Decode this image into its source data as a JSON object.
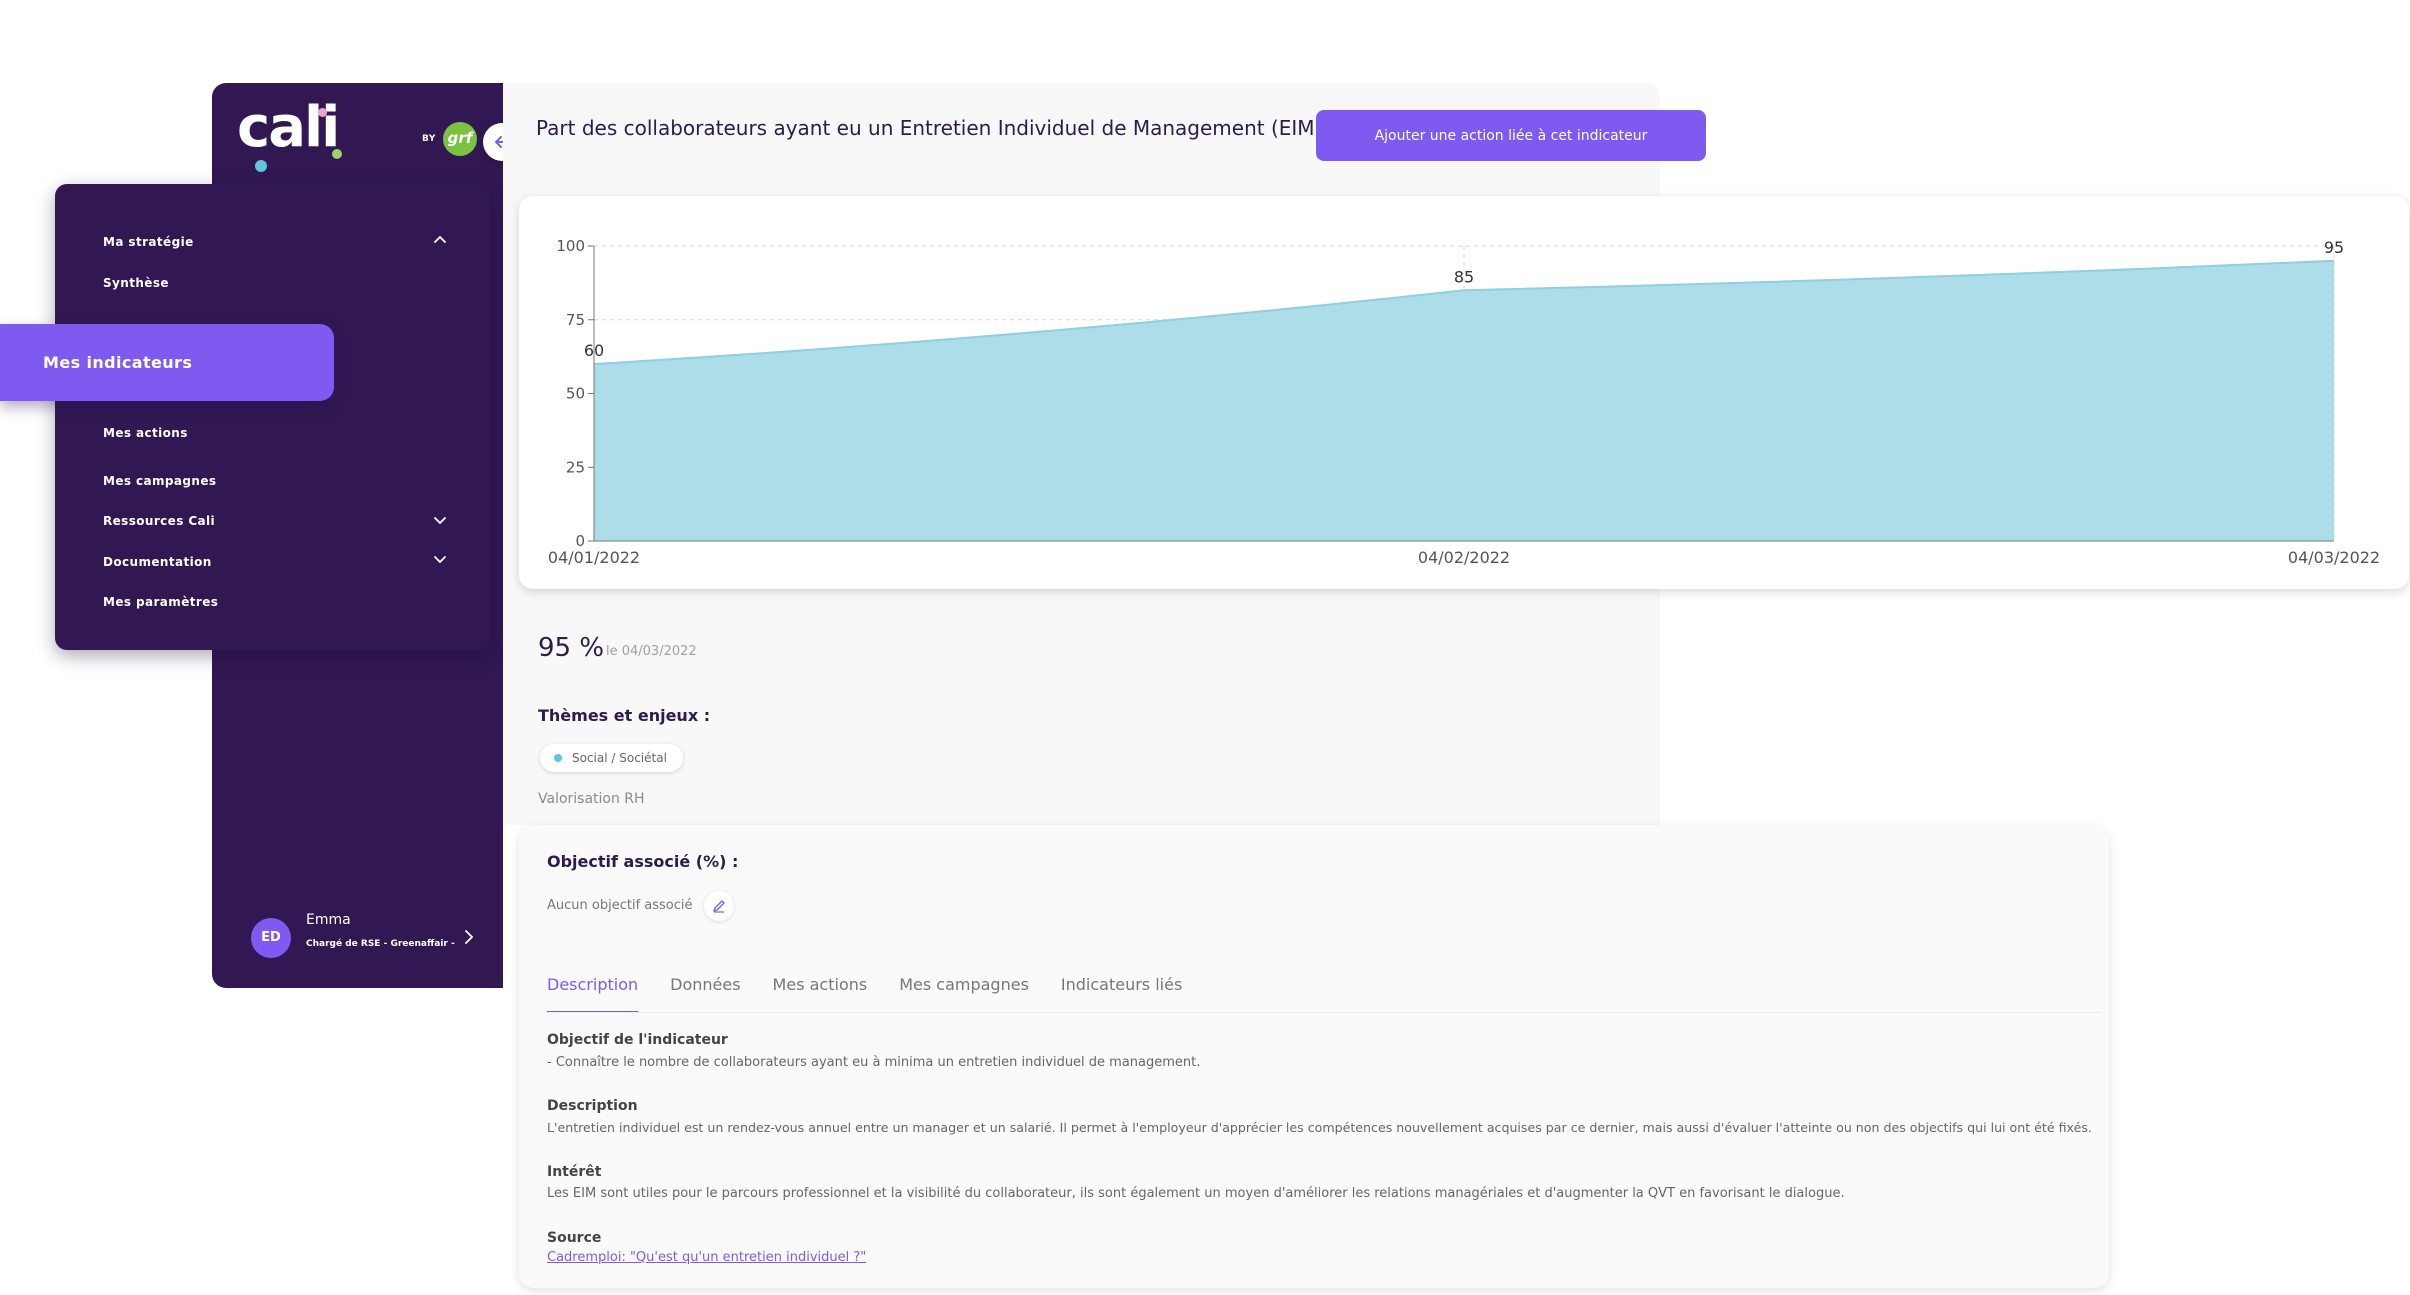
{
  "brand": {
    "logo_text": "cali",
    "by_label": "BY",
    "partner_badge": "grf",
    "colors": {
      "sidebar": "#311853",
      "accent": "#7f5af0",
      "area_fill": "#acdde8",
      "area_stroke": "#8fcfdf"
    }
  },
  "sidebar": {
    "collapse_icon": "arrow-left-icon",
    "items": [
      {
        "label": "Ma stratégie",
        "chevron": "up"
      },
      {
        "label": "Synthèse"
      },
      {
        "label": "Mes indicateurs",
        "active": true
      },
      {
        "label": "Mes actions"
      },
      {
        "label": "Mes campagnes"
      },
      {
        "label": "Ressources Cali",
        "chevron": "down"
      },
      {
        "label": "Documentation",
        "chevron": "down"
      },
      {
        "label": "Mes paramètres"
      }
    ],
    "user": {
      "initials": "ED",
      "name": "Emma",
      "role": "Chargé de RSE - Greenaffair -"
    }
  },
  "header": {
    "title": "Part des collaborateurs ayant eu un Entretien Individuel de Management (EIM)",
    "add_action_label": "Ajouter une action liée à cet indicateur"
  },
  "chart_data": {
    "type": "area",
    "x": [
      "04/01/2022",
      "04/02/2022",
      "04/03/2022"
    ],
    "values": [
      60,
      85,
      95
    ],
    "data_labels": [
      "60",
      "85",
      "95"
    ],
    "yticks": [
      0,
      25,
      50,
      75,
      100
    ],
    "ylim": [
      0,
      100
    ],
    "grid": true,
    "title": "",
    "xlabel": "",
    "ylabel": ""
  },
  "summary": {
    "value": "95 %",
    "date": "le 04/03/2022"
  },
  "themes": {
    "title": "Thèmes et enjeux :",
    "chip": "Social / Sociétal",
    "sub": "Valorisation RH"
  },
  "objective": {
    "title": "Objectif associé (%) :",
    "empty_text": "Aucun objectif associé"
  },
  "tabs": [
    {
      "label": "Description",
      "active": true
    },
    {
      "label": "Données"
    },
    {
      "label": "Mes actions"
    },
    {
      "label": "Mes campagnes"
    },
    {
      "label": "Indicateurs liés"
    }
  ],
  "details": {
    "objective_label": "Objectif de l'indicateur",
    "objective_text": "- Connaître le nombre de collaborateurs ayant eu à minima un entretien individuel de management.",
    "description_label": "Description",
    "description_text": "L'entretien individuel est un rendez-vous annuel entre un manager et un salarié. Il permet à l'employeur d'apprécier les compétences nouvellement acquises par ce dernier, mais aussi d'évaluer l'atteinte ou non des objectifs qui lui ont été fixés.",
    "interest_label": "Intérêt",
    "interest_text": "Les EIM sont utiles pour le parcours professionnel et la visibilité du collaborateur, ils sont également un moyen d'améliorer les relations managériales et d'augmenter la QVT en favorisant le dialogue.",
    "source_label": "Source",
    "source_link": "Cadremploi: \"Qu'est qu'un entretien individuel ?\""
  }
}
